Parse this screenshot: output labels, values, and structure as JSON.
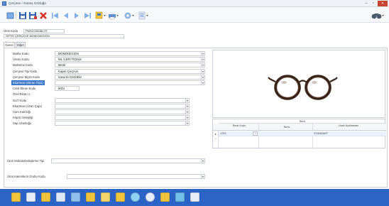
{
  "window": {
    "title": "Çerçeve / Güneş Gözlüğü",
    "min": "–",
    "max": "▫",
    "close": "✕"
  },
  "toolbar": {
    "icons": [
      "home-icon",
      "save-icon",
      "save-as-icon",
      "delete-icon",
      "first-icon",
      "prev-icon",
      "next-icon",
      "last-icon",
      "layout-icon",
      "print-icon",
      "settings-icon",
      "list-icon",
      "binoculars-icon"
    ]
  },
  "header": {
    "code_label": "Ürün Kodu",
    "code_value": "PMSC0300BLOT",
    "name_value": "OPTİK ÇERÇEVE MOMODESIGN"
  },
  "tabs": [
    {
      "label": "Genel"
    },
    {
      "label": "Diğer"
    }
  ],
  "form": {
    "fields": [
      {
        "label": "Marka Kodu",
        "value": "MOMODESIGN"
      },
      {
        "label": "Üretici Kodu",
        "value": "İNL İLERİ TİCELE"
      },
      {
        "label": "Malzeme Kodu",
        "value": "Metal"
      },
      {
        "label": "Çerçeve Tipi Kodu",
        "value": "Kapalı Çerçeve"
      },
      {
        "label": "Çerçeve Biçim Kodu",
        "value": "Kavunlu Gözlükler"
      },
      {
        "label": "Ekartman (Ekran Ölçü)",
        "value": ""
      },
      {
        "label": "Cinsl Ekran Kodu",
        "value": "5001"
      },
      {
        "label": "Özel Ekran 1",
        "value": ""
      },
      {
        "label": "SUT Kodu",
        "value": ""
      },
      {
        "label": "Ekartman (Ürün Çapı)",
        "value": ""
      },
      {
        "label": "Cam Kalınlığı",
        "value": ""
      },
      {
        "label": "Köprü Genişliği",
        "value": ""
      },
      {
        "label": "Sap Uzunluğu",
        "value": ""
      }
    ],
    "bottom_fields": [
      {
        "label": "Ürün Muhasebeleştirme Tipi",
        "value": ""
      },
      {
        "label": "Ürün Kalemlerin Grubu Kodu",
        "value": ""
      }
    ]
  },
  "grid": {
    "group_header": "Renk",
    "headers": [
      "Renk Kodu",
      "Renk",
      "Uzatı Açıklaması"
    ],
    "rows": [
      {
        "code": "1763",
        "color": "",
        "desc": "STANDART"
      }
    ]
  },
  "taskbar": {
    "icons": [
      "folder-icon",
      "window-icon",
      "mail-icon",
      "calc-icon",
      "monitor-icon",
      "pen-icon",
      "chart-icon",
      "phone-icon",
      "globe-icon",
      "gear-icon",
      "folder2-icon",
      "people-icon",
      "display-icon"
    ]
  }
}
